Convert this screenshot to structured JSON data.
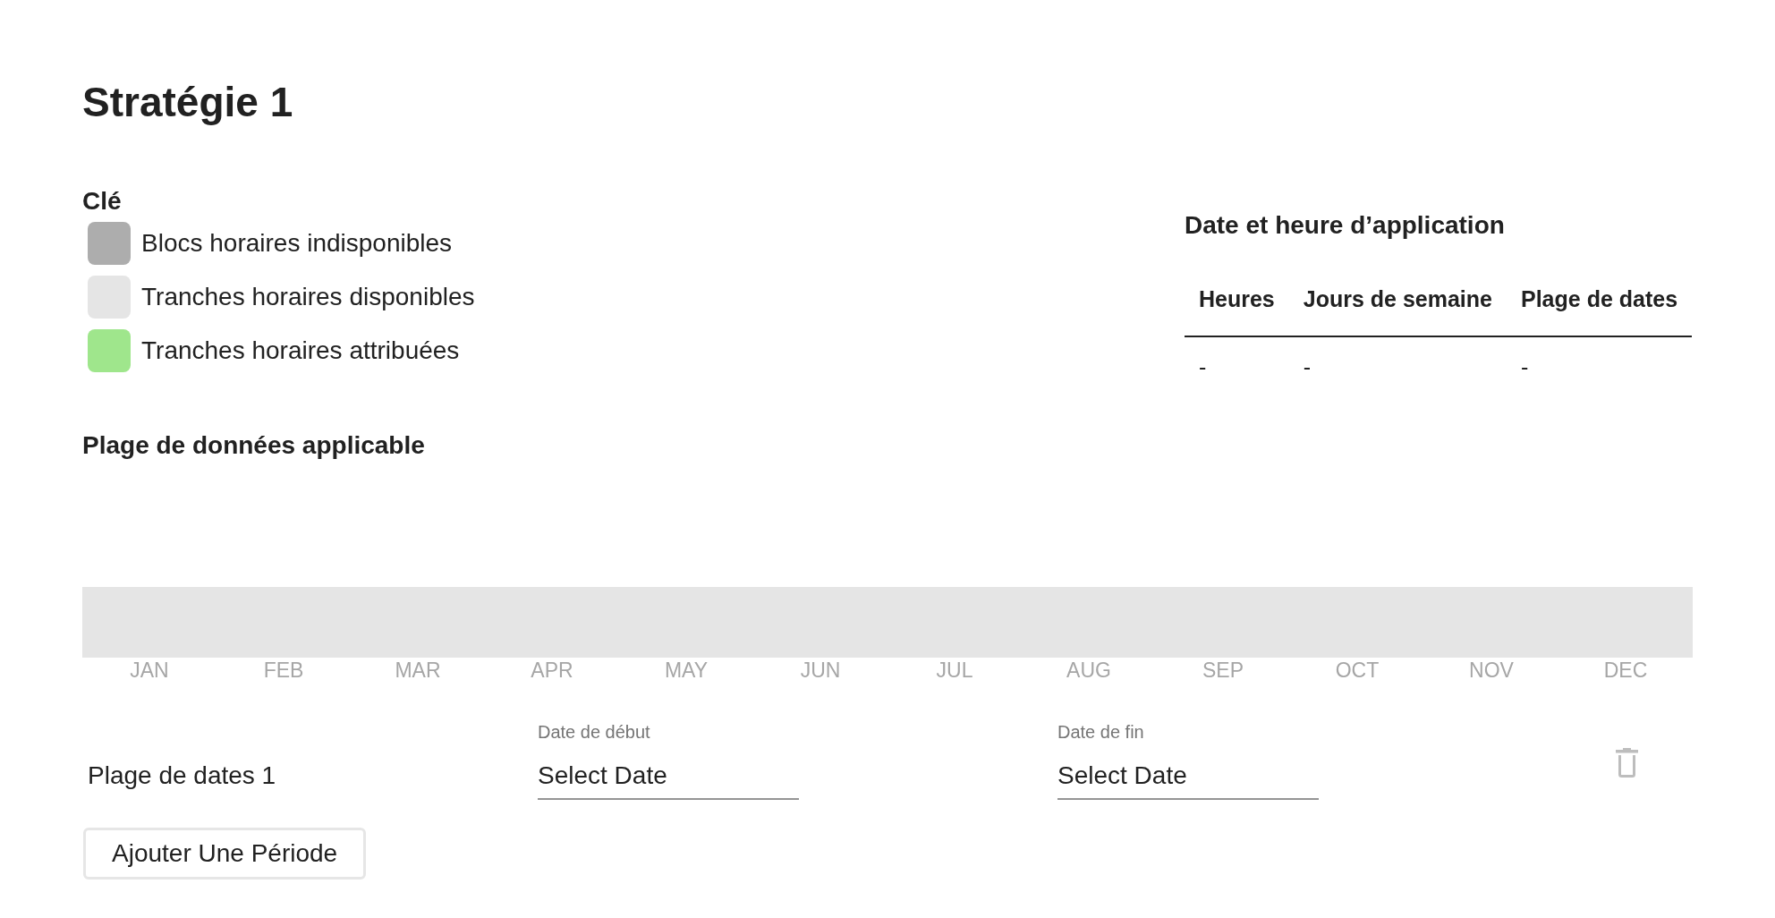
{
  "title": "Stratégie 1",
  "key": {
    "title": "Clé",
    "items": [
      {
        "label": "Blocs horaires indisponibles",
        "color": "#adadad"
      },
      {
        "label": "Tranches horaires disponibles",
        "color": "#e5e5e5"
      },
      {
        "label": "Tranches horaires attribuées",
        "color": "#9fe68c"
      }
    ]
  },
  "applicable_range": {
    "title": "Plage de données applicable",
    "months": [
      "JAN",
      "FEB",
      "MAR",
      "APR",
      "MAY",
      "JUN",
      "JUL",
      "AUG",
      "SEP",
      "OCT",
      "NOV",
      "DEC"
    ]
  },
  "application_schedule": {
    "title": "Date et heure d’application",
    "columns": [
      "Heures",
      "Jours de semaine",
      "Plage de dates"
    ],
    "rows": [
      [
        "-",
        "-",
        "-"
      ]
    ]
  },
  "date_ranges": [
    {
      "label": "Plage de dates 1",
      "start": {
        "label": "Date de début",
        "placeholder": "Select Date"
      },
      "end": {
        "label": "Date de fin",
        "placeholder": "Select Date"
      }
    }
  ],
  "add_button": {
    "label": "Ajouter Une Période"
  }
}
